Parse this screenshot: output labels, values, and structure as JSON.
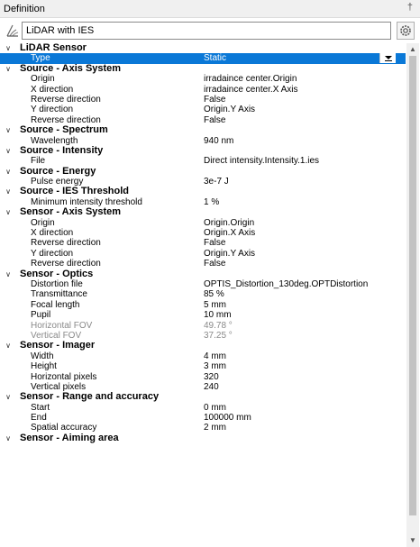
{
  "panel": {
    "title": "Definition",
    "pin_glyph": "†"
  },
  "name_field": {
    "value": "LiDAR with IES",
    "icon": "lidar-sensor-icon"
  },
  "settings_icon": "gear-icon",
  "grid": {
    "rows": [
      {
        "kind": "cat",
        "label": "LiDAR Sensor"
      },
      {
        "kind": "prop",
        "label": "Type",
        "value": "Static",
        "selected": true,
        "dropdown": true
      },
      {
        "kind": "cat",
        "label": "Source - Axis System"
      },
      {
        "kind": "prop",
        "label": "Origin",
        "value": "irradaince center.Origin"
      },
      {
        "kind": "prop",
        "label": "X direction",
        "value": "irradaince center.X Axis"
      },
      {
        "kind": "prop",
        "label": "Reverse direction",
        "value": "False"
      },
      {
        "kind": "prop",
        "label": "Y direction",
        "value": "Origin.Y Axis"
      },
      {
        "kind": "prop",
        "label": "Reverse direction",
        "value": "False"
      },
      {
        "kind": "cat",
        "label": "Source - Spectrum"
      },
      {
        "kind": "prop",
        "label": "Wavelength",
        "value": "940 nm"
      },
      {
        "kind": "cat",
        "label": "Source - Intensity"
      },
      {
        "kind": "prop",
        "label": "File",
        "value": "Direct intensity.Intensity.1.ies"
      },
      {
        "kind": "cat",
        "label": "Source - Energy"
      },
      {
        "kind": "prop",
        "label": "Pulse energy",
        "value": "3e-7 J"
      },
      {
        "kind": "cat",
        "label": "Source - IES Threshold"
      },
      {
        "kind": "prop",
        "label": "Minimum intensity threshold",
        "value": "1 %"
      },
      {
        "kind": "cat",
        "label": "Sensor - Axis System"
      },
      {
        "kind": "prop",
        "label": "Origin",
        "value": "Origin.Origin"
      },
      {
        "kind": "prop",
        "label": "X direction",
        "value": "Origin.X Axis"
      },
      {
        "kind": "prop",
        "label": "Reverse direction",
        "value": "False"
      },
      {
        "kind": "prop",
        "label": "Y direction",
        "value": "Origin.Y Axis"
      },
      {
        "kind": "prop",
        "label": "Reverse direction",
        "value": "False"
      },
      {
        "kind": "cat",
        "label": "Sensor - Optics"
      },
      {
        "kind": "prop",
        "label": "Distortion file",
        "value": "OPTIS_Distortion_130deg.OPTDistortion"
      },
      {
        "kind": "prop",
        "label": "Transmittance",
        "value": "85 %"
      },
      {
        "kind": "prop",
        "label": "Focal length",
        "value": "5 mm"
      },
      {
        "kind": "prop",
        "label": "Pupil",
        "value": "10 mm"
      },
      {
        "kind": "prop",
        "label": "Horizontal FOV",
        "value": "49.78 °",
        "disabled": true
      },
      {
        "kind": "prop",
        "label": "Vertical FOV",
        "value": "37.25 °",
        "disabled": true
      },
      {
        "kind": "cat",
        "label": "Sensor - Imager"
      },
      {
        "kind": "prop",
        "label": "Width",
        "value": "4 mm"
      },
      {
        "kind": "prop",
        "label": "Height",
        "value": "3 mm"
      },
      {
        "kind": "prop",
        "label": "Horizontal pixels",
        "value": "320"
      },
      {
        "kind": "prop",
        "label": "Vertical pixels",
        "value": "240"
      },
      {
        "kind": "cat",
        "label": "Sensor - Range and accuracy"
      },
      {
        "kind": "prop",
        "label": "Start",
        "value": "0 mm"
      },
      {
        "kind": "prop",
        "label": "End",
        "value": "100000 mm"
      },
      {
        "kind": "prop",
        "label": "Spatial accuracy",
        "value": "2 mm"
      },
      {
        "kind": "cat",
        "label": "Sensor - Aiming area"
      }
    ]
  },
  "scrollbar": {
    "position_fraction": 0.0,
    "visible_fraction": 0.96
  },
  "colors": {
    "selection": "#0a78d7",
    "disabled_text": "#8a8a8a"
  }
}
